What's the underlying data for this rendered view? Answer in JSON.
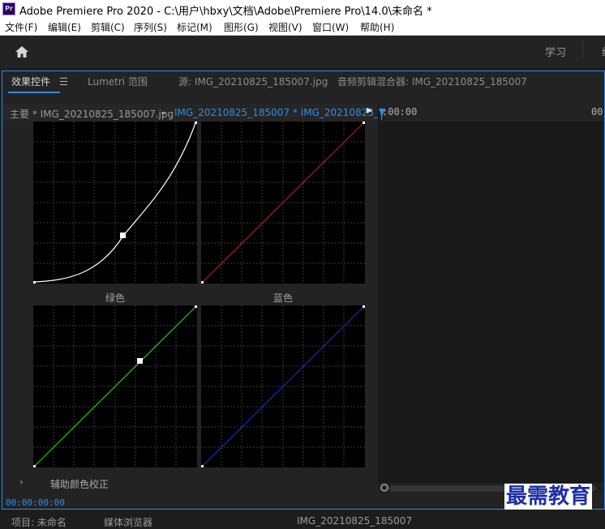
{
  "window": {
    "app_icon": "Pr",
    "title": "Adobe Premiere Pro 2020 - C:\\用户\\hbxy\\文档\\Adobe\\Premiere Pro\\14.0\\未命名 *"
  },
  "menu": [
    "文件(F)",
    "编辑(E)",
    "剪辑(C)",
    "序列(S)",
    "标记(M)",
    "图形(G)",
    "视图(V)",
    "窗口(W)",
    "帮助(H)"
  ],
  "workspaces": {
    "home_icon": "home-icon",
    "learn": "学习",
    "next": "编"
  },
  "tabs": {
    "effects": "效果控件",
    "lumetri_scopes": "Lumetri 范围",
    "source": "源: IMG_20210825_185007.jpg",
    "audio_mixer": "音频剪辑混合器: IMG_20210825_185007"
  },
  "clip_header": {
    "master": "主要 * IMG_20210825_185007.jpg",
    "chevron_icon": "chevron-down-icon",
    "sequence": "IMG_20210825_185007 * IMG_20210825_...",
    "play_icon": "play-icon"
  },
  "curves": {
    "master_color": "#ffffff",
    "red_color": "#b0201a",
    "green_color": "#3cb82a",
    "blue_color": "#1a2ab8",
    "green_label": "绿色",
    "blue_label": "蓝色"
  },
  "aux": {
    "label": "辅助颜色校正",
    "chevron_icon": "chevron-right-icon"
  },
  "timecode": "00:00:00:00",
  "timeline": {
    "ruler_start": ":00:00",
    "ruler_end": "00:"
  },
  "bottom_tabs": [
    "项目: 未命名",
    "媒体浏览器",
    "IMG_20210825_185007"
  ],
  "watermark": "最需教育",
  "accent_color": "#2d8ceb"
}
